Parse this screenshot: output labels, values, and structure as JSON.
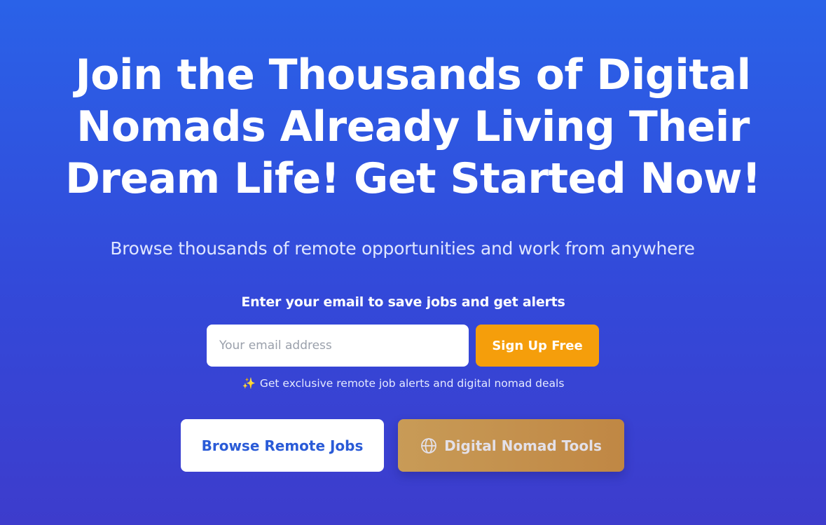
{
  "hero": {
    "headline_lines": [
      "Join the Thousands of Digital",
      "Nomads Already Living Their",
      "Dream Life! Get Started Now!"
    ],
    "subtitle": "Browse thousands of remote opportunities and work from anywhere"
  },
  "signup": {
    "label": "Enter your email to save jobs and get alerts",
    "email_placeholder": "Your email address",
    "email_value": "",
    "submit_label": "Sign Up Free",
    "perk_icon": "sparkles-icon",
    "perk_emoji": "✨",
    "perk_text": "Get exclusive remote job alerts and digital nomad deals"
  },
  "actions": {
    "browse_label": "Browse Remote Jobs",
    "tools_label": "Digital Nomad Tools",
    "tools_icon": "globe-icon"
  },
  "colors": {
    "background_top": "#2a62e8",
    "background_bottom": "#3d3ccc",
    "accent_orange": "#f59e0b",
    "browse_text": "#2a5bd7",
    "tools_gradient_start": "#c89b57",
    "tools_gradient_end": "#c08744"
  }
}
